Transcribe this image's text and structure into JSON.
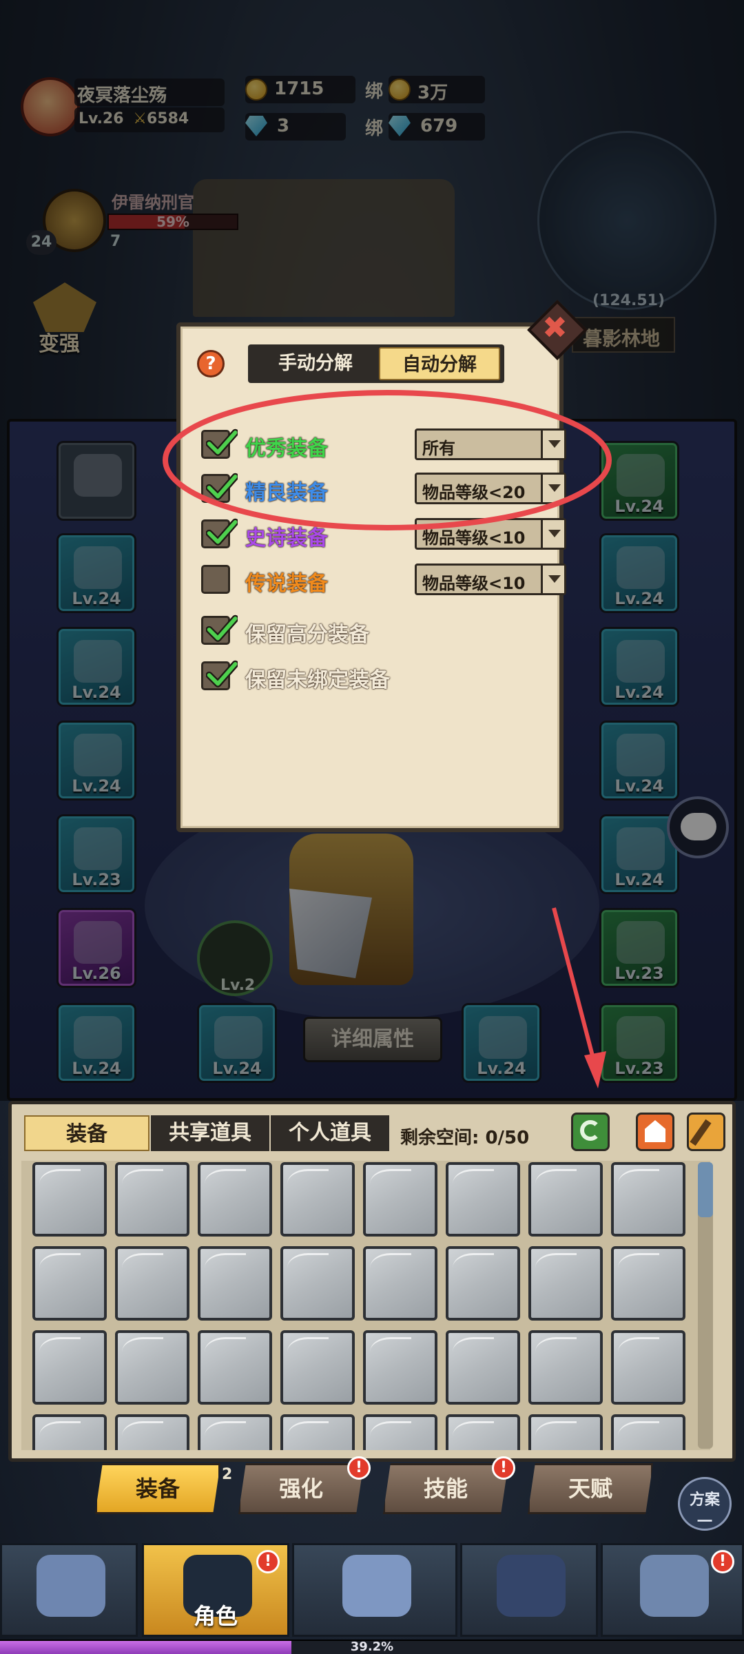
{
  "player": {
    "name": "夜冥落尘殇",
    "level": "Lv.26",
    "power": "6584"
  },
  "currency": {
    "gold": "1715",
    "bound_gold": "3万",
    "gems": "3",
    "bound_gems": "679",
    "bound_label": "绑"
  },
  "quest": {
    "boss_name": "伊雷纳刑官",
    "progress": "59%",
    "progress_value": 0.59,
    "badge_left": "24",
    "badge_right": "7"
  },
  "side": {
    "strengthen": "变强"
  },
  "map": {
    "coords": "(124.51)",
    "location": "暮影林地"
  },
  "dialog": {
    "help": "?",
    "tabs": [
      "手动分解",
      "自动分解"
    ],
    "active_tab": 1,
    "rows": [
      {
        "label": "优秀装备",
        "checked": true,
        "color": "#3fd44a",
        "select": "所有"
      },
      {
        "label": "精良装备",
        "checked": true,
        "color": "#3e8ce8",
        "select": "物品等级<20"
      },
      {
        "label": "史诗装备",
        "checked": true,
        "color": "#a94ae8",
        "select": "物品等级<10"
      },
      {
        "label": "传说装备",
        "checked": false,
        "color": "#f08a1c",
        "select": "物品等级<10"
      },
      {
        "label": "保留高分装备",
        "checked": true,
        "color": "#f3ead8"
      },
      {
        "label": "保留未绑定装备",
        "checked": true,
        "color": "#f3ead8"
      }
    ]
  },
  "equip_left": [
    {
      "lv": "",
      "type": "empty"
    },
    {
      "lv": "Lv.24",
      "type": "blue"
    },
    {
      "lv": "Lv.24",
      "type": "blue"
    },
    {
      "lv": "Lv.24",
      "type": "blue"
    },
    {
      "lv": "Lv.23",
      "type": "blue"
    },
    {
      "lv": "Lv.26",
      "type": "purple"
    },
    {
      "lv": "Lv.24",
      "type": "blue"
    }
  ],
  "equip_right": [
    {
      "lv": "Lv.24",
      "type": "green"
    },
    {
      "lv": "Lv.24",
      "type": "blue"
    },
    {
      "lv": "Lv.24",
      "type": "blue"
    },
    {
      "lv": "Lv.24",
      "type": "blue"
    },
    {
      "lv": "Lv.24",
      "type": "blue"
    },
    {
      "lv": "Lv.23",
      "type": "green"
    },
    {
      "lv": "Lv.23",
      "type": "green"
    }
  ],
  "center": {
    "detail_button": "详细属性",
    "pet_lv": "Lv.2",
    "bottom_slot_lv": [
      "Lv.24",
      "Lv.24"
    ]
  },
  "inventory": {
    "tabs": [
      "装备",
      "共享道具",
      "个人道具"
    ],
    "active_tab": 0,
    "space": "剩余空间: 0/50"
  },
  "bottom_tabs": [
    {
      "label": "装备",
      "active": true
    },
    {
      "label": "强化",
      "active": false,
      "badge": "!"
    },
    {
      "label": "技能",
      "active": false,
      "badge": "!"
    },
    {
      "label": "天赋",
      "active": false
    }
  ],
  "plan_button": {
    "line1": "方案",
    "line2": "一"
  },
  "nav": [
    {
      "label": "",
      "icon": "rock-icon"
    },
    {
      "label": "角色",
      "icon": "character-icon",
      "active": true,
      "badge": "!"
    },
    {
      "label": "",
      "icon": "battle-icon"
    },
    {
      "label": "",
      "icon": "gate-icon"
    },
    {
      "label": "",
      "icon": "castle-icon",
      "badge": "!"
    }
  ],
  "exp": {
    "percent": "39.2%",
    "value": 0.392
  },
  "colors": {
    "annotation_red": "#e8484c",
    "accent_gold": "#f1d68c"
  }
}
